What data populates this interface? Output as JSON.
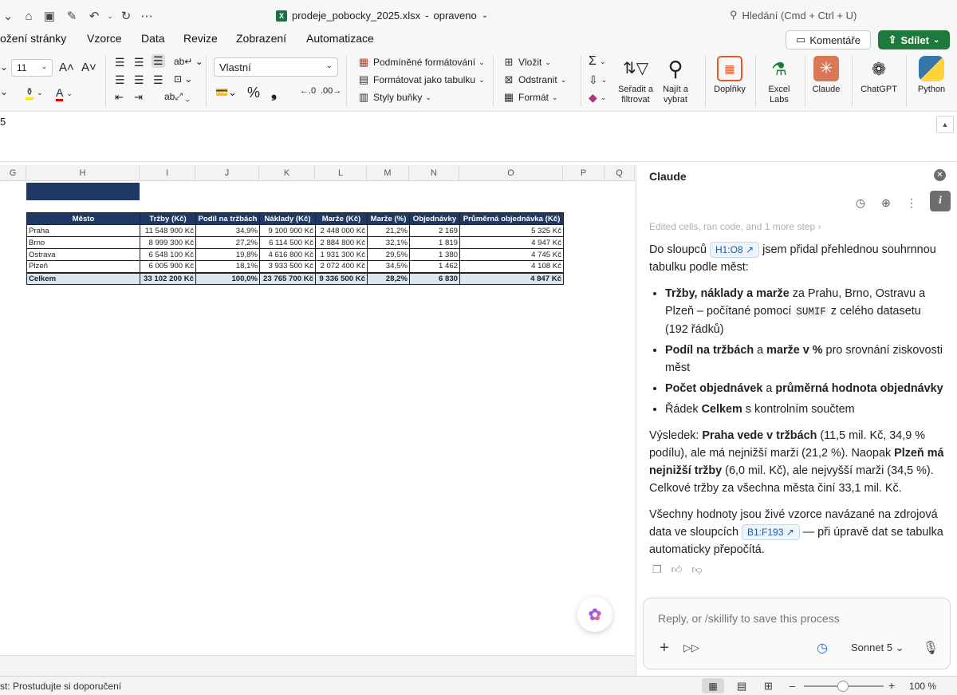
{
  "titlebar": {
    "filename": "prodeje_pobocky_2025.xlsx",
    "separator": "-",
    "status": "opraveno",
    "search_label": "Hledání (Cmd + Ctrl + U)"
  },
  "menu": {
    "tabs": [
      "ožení stránky",
      "Vzorce",
      "Data",
      "Revize",
      "Zobrazení",
      "Automatizace"
    ],
    "comments_label": "Komentáře",
    "share_label": "Sdílet"
  },
  "ribbon": {
    "font_size": "11",
    "number_format": "Vlastní",
    "conditional_formatting": "Podmíněné formátování",
    "format_as_table": "Formátovat jako tabulku",
    "cell_styles": "Styly buňky",
    "insert": "Vložit",
    "delete": "Odstranit",
    "format": "Formát",
    "sort_filter": [
      "Seřadit a",
      "filtrovat"
    ],
    "find_select": [
      "Najít a",
      "vybrat"
    ],
    "addins": "Doplňky",
    "excel_labs": [
      "Excel",
      "Labs"
    ],
    "claude": "Claude",
    "chatgpt": "ChatGPT",
    "python": "Python",
    "accent_green": "#1e7a3c"
  },
  "formula_bar": {
    "content": "5"
  },
  "sheet": {
    "columns": [
      "G",
      "H",
      "I",
      "J",
      "K",
      "L",
      "M",
      "N",
      "O",
      "P",
      "Q"
    ],
    "header_color": "#1f3864",
    "table": {
      "headers": [
        "Město",
        "Tržby (Kč)",
        "Podíl na tržbách",
        "Náklady (Kč)",
        "Marže (Kč)",
        "Marže (%)",
        "Objednávky",
        "Průměrná objednávka (Kč)"
      ],
      "rows": [
        [
          "Praha",
          "11 548 900 Kč",
          "34,9%",
          "9 100 900 Kč",
          "2 448 000 Kč",
          "21,2%",
          "2 169",
          "5 325 Kč"
        ],
        [
          "Brno",
          "8 999 300 Kč",
          "27,2%",
          "6 114 500 Kč",
          "2 884 800 Kč",
          "32,1%",
          "1 819",
          "4 947 Kč"
        ],
        [
          "Ostrava",
          "6 548 100 Kč",
          "19,8%",
          "4 616 800 Kč",
          "1 931 300 Kč",
          "29,5%",
          "1 380",
          "4 745 Kč"
        ],
        [
          "Plzeň",
          "6 005 900 Kč",
          "18,1%",
          "3 933 500 Kč",
          "2 072 400 Kč",
          "34,5%",
          "1 462",
          "4 108 Kč"
        ]
      ],
      "total": [
        "Celkem",
        "33 102 200 Kč",
        "100,0%",
        "23 765 700 Kč",
        "9 336 500 Kč",
        "28,2%",
        "6 830",
        "4 847 Kč"
      ]
    }
  },
  "status_bar": {
    "left_text": "st: Prostudujte si doporučení",
    "zoom": "100 %"
  },
  "claude_panel": {
    "title": "Claude",
    "edited_line": "Edited cells, ran code, and 1 more step",
    "intro_before": "Do sloupců",
    "intro_ref": "H1:O8",
    "intro_after": "jsem přidal přehlednou souhrnnou tabulku podle měst:",
    "bullet1": {
      "b1": "Tržby, náklady a marže",
      "t1": " za Prahu, Brno, Ostravu a Plzeň – počítané pomocí ",
      "code": "SUMIF",
      "t2": " z celého datasetu (192 řádků)"
    },
    "bullet2": {
      "b1": "Podíl na tržbách",
      "t1": " a ",
      "b2": "marže v %",
      "t2": " pro srovnání ziskovosti měst"
    },
    "bullet3": {
      "b1": "Počet objednávek",
      "t1": " a ",
      "b2": "průměrná hodnota objednávky"
    },
    "bullet4": {
      "t1": "Řádek ",
      "b1": "Celkem",
      "t2": " s kontrolním součtem"
    },
    "result": {
      "t1": "Výsledek: ",
      "b1": "Praha vede v tržbách",
      "t2": " (11,5 mil. Kč, 34,9 % podílu), ale má nejnižší marži (21,2 %). Naopak ",
      "b2": "Plzeň má nejnižší tržby",
      "t3": " (6,0 mil. Kč), ale nejvyšší marži (34,5 %). Celkové tržby za všechna města činí 33,1 mil. Kč."
    },
    "closing": {
      "t1": "Všechny hodnoty jsou živé vzorce navázané na zdrojová data ve sloupcích ",
      "ref": "B1:F193",
      "t2": " — při úpravě dat se tabulka automaticky přepočítá."
    },
    "reply_placeholder": "Reply, or /skillify to save this process",
    "model": "Sonnet 5"
  }
}
